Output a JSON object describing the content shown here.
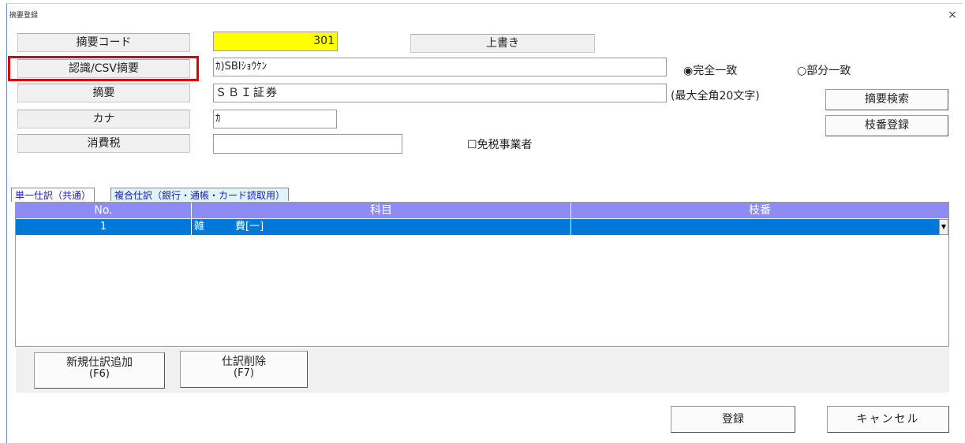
{
  "window": {
    "title": "摘要登録",
    "close_glyph": "×"
  },
  "form": {
    "code_label": "摘要コード",
    "code_value": "301",
    "overwrite_label": "上書き",
    "csv_label": "認識/CSV摘要",
    "csv_value": "ｶ)SBIｼｮｳｹﾝ",
    "match_exact_label": "◉完全一致",
    "match_partial_label": "○部分一致",
    "summary_label": "摘要",
    "summary_value": "ＳＢＩ証券",
    "summary_hint": "(最大全角20文字)",
    "kana_label": "カナ",
    "kana_value": "ｶ",
    "tax_label": "消費税",
    "tax_value": "",
    "tax_exempt_label": "☐免税事業者",
    "search_button": "摘要検索",
    "branch_button": "枝番登録"
  },
  "tabs": [
    {
      "label": "単一仕訳（共通）"
    },
    {
      "label": "複合仕訳（銀行・通帳・カード読取用）"
    }
  ],
  "grid": {
    "headers": [
      "No.",
      "科目",
      "枝番"
    ],
    "rows": [
      {
        "no": "1",
        "subject": "雑　　　費[一]",
        "branch": ""
      }
    ]
  },
  "actions": {
    "add_label": "新規仕訳追加",
    "add_key": "(F6)",
    "delete_label": "仕訳削除",
    "delete_key": "(F7)",
    "register_label": "登録",
    "cancel_label": "キャンセル"
  },
  "colors": {
    "highlight_field": "#ffff00",
    "grid_header": "#8c8cf2",
    "selected_row": "#0078d7",
    "annotation_box": "#e00000"
  }
}
